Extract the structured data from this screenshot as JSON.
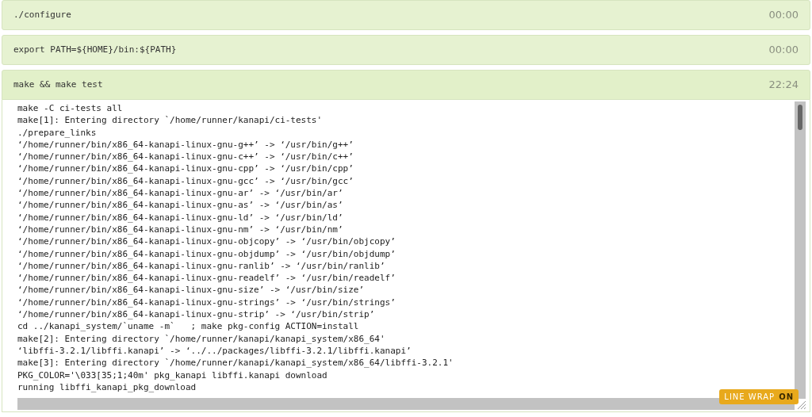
{
  "steps": [
    {
      "command": "./configure",
      "time": "00:00",
      "expanded": false
    },
    {
      "command": "export PATH=${HOME}/bin:${PATH}",
      "time": "00:00",
      "expanded": false
    },
    {
      "command": "make && make test",
      "time": "22:24",
      "expanded": true,
      "log": [
        "make -C ci-tests all",
        "make[1]: Entering directory `/home/runner/kanapi/ci-tests'",
        "./prepare_links",
        "‘/home/runner/bin/x86_64-kanapi-linux-gnu-g++’ -> ‘/usr/bin/g++’",
        "‘/home/runner/bin/x86_64-kanapi-linux-gnu-c++’ -> ‘/usr/bin/c++’",
        "‘/home/runner/bin/x86_64-kanapi-linux-gnu-cpp’ -> ‘/usr/bin/cpp’",
        "‘/home/runner/bin/x86_64-kanapi-linux-gnu-gcc’ -> ‘/usr/bin/gcc’",
        "‘/home/runner/bin/x86_64-kanapi-linux-gnu-ar’ -> ‘/usr/bin/ar’",
        "‘/home/runner/bin/x86_64-kanapi-linux-gnu-as’ -> ‘/usr/bin/as’",
        "‘/home/runner/bin/x86_64-kanapi-linux-gnu-ld’ -> ‘/usr/bin/ld’",
        "‘/home/runner/bin/x86_64-kanapi-linux-gnu-nm’ -> ‘/usr/bin/nm’",
        "‘/home/runner/bin/x86_64-kanapi-linux-gnu-objcopy’ -> ‘/usr/bin/objcopy’",
        "‘/home/runner/bin/x86_64-kanapi-linux-gnu-objdump’ -> ‘/usr/bin/objdump’",
        "‘/home/runner/bin/x86_64-kanapi-linux-gnu-ranlib’ -> ‘/usr/bin/ranlib’",
        "‘/home/runner/bin/x86_64-kanapi-linux-gnu-readelf’ -> ‘/usr/bin/readelf’",
        "‘/home/runner/bin/x86_64-kanapi-linux-gnu-size’ -> ‘/usr/bin/size’",
        "‘/home/runner/bin/x86_64-kanapi-linux-gnu-strings’ -> ‘/usr/bin/strings’",
        "‘/home/runner/bin/x86_64-kanapi-linux-gnu-strip’ -> ‘/usr/bin/strip’",
        "cd ../kanapi_system/`uname -m`   ; make pkg-config ACTION=install",
        "make[2]: Entering directory `/home/runner/kanapi/kanapi_system/x86_64'",
        "‘libffi-3.2.1/libffi.kanapi’ -> ‘../../packages/libffi-3.2.1/libffi.kanapi’",
        "make[3]: Entering directory `/home/runner/kanapi/kanapi_system/x86_64/libffi-3.2.1'",
        "PKG_COLOR='\\033[35;1;40m' pkg_kanapi libffi.kanapi download",
        "running libffi_kanapi_pkg_download"
      ]
    }
  ],
  "line_wrap": {
    "label": "LINE WRAP",
    "value": "ON",
    "on": true
  }
}
